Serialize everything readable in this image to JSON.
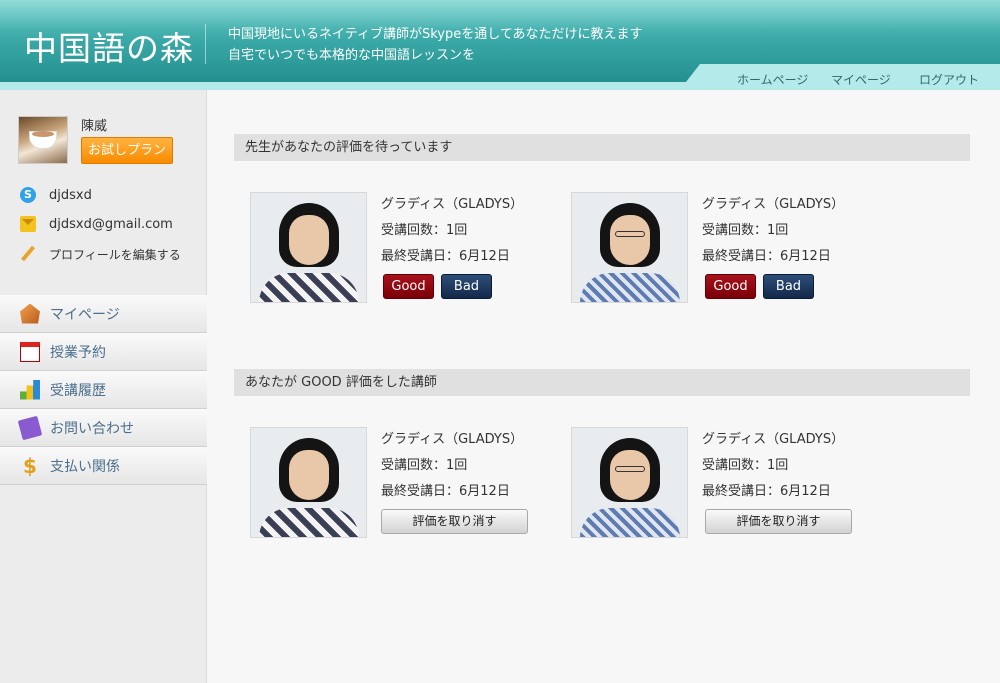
{
  "header": {
    "logo": "中国語の森",
    "tagline_line1": "中国現地にいるネイティブ講師がSkypeを通してあなただけに教えます",
    "tagline_line2": "自宅でいつでも本格的な中国語レッスンを",
    "nav": [
      "ホームページ",
      "マイページ",
      "ログアウト"
    ]
  },
  "profile": {
    "name": "陳威",
    "plan_button": "お試しプラン",
    "skype": "djdsxd",
    "email": "djdsxd@gmail.com",
    "edit_profile": "プロフィールを編集する"
  },
  "menu": [
    {
      "label": "マイページ",
      "icon": "house-icon"
    },
    {
      "label": "授業予約",
      "icon": "calendar-icon"
    },
    {
      "label": "受講履歴",
      "icon": "chart-icon"
    },
    {
      "label": "お問い合わせ",
      "icon": "envelope-icon"
    },
    {
      "label": "支払い関係",
      "icon": "dollar-icon"
    }
  ],
  "pending": {
    "title": "先生があなたの評価を待っています",
    "good_label": "Good",
    "bad_label": "Bad",
    "teachers": [
      {
        "name": "グラディス（GLADYS）",
        "count": "受講回数：1回",
        "last": "最終受講日：6月12日"
      },
      {
        "name": "グラディス（GLADYS）",
        "count": "受講回数：1回",
        "last": "最終受講日：6月12日"
      }
    ]
  },
  "rated": {
    "title": "あなたが GOOD 評価をした講師",
    "cancel_label": "評価を取り消す",
    "teachers": [
      {
        "name": "グラディス（GLADYS）",
        "count": "受講回数：1回",
        "last": "最終受講日：6月12日"
      },
      {
        "name": "グラディス（GLADYS）",
        "count": "受講回数：1回",
        "last": "最終受講日：6月12日"
      }
    ]
  },
  "colors": {
    "header_teal": "#3aa8a6",
    "nav_band": "#b4ebea",
    "good": "#8f0a13",
    "bad": "#1f3a60",
    "trial": "#f98b00"
  }
}
